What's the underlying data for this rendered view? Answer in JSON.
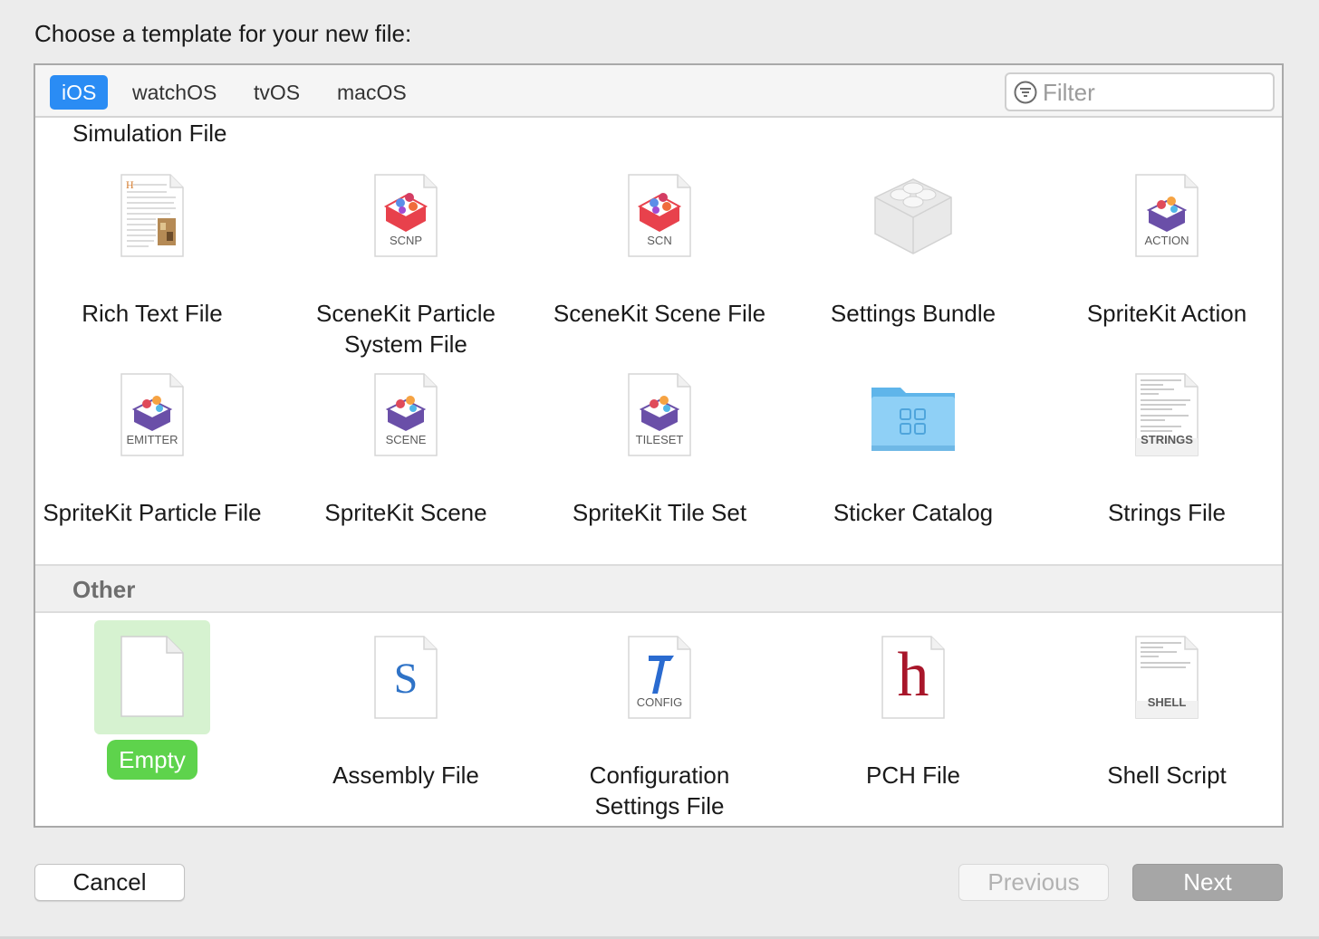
{
  "dialog": {
    "title": "Choose a template for your new file:"
  },
  "platform_tabs": [
    {
      "label": "iOS",
      "active": true
    },
    {
      "label": "watchOS",
      "active": false
    },
    {
      "label": "tvOS",
      "active": false
    },
    {
      "label": "macOS",
      "active": false
    }
  ],
  "filter": {
    "placeholder": "Filter",
    "value": ""
  },
  "sections": {
    "simulation": {
      "title": "Simulation File",
      "templates": [
        {
          "label": "Rich Text File",
          "icon": "rich-text-document-icon",
          "badge": ""
        },
        {
          "label": "SceneKit Particle System File",
          "icon": "scenekit-icon",
          "badge": "SCNP"
        },
        {
          "label": "SceneKit Scene File",
          "icon": "scenekit-icon",
          "badge": "SCN"
        },
        {
          "label": "Settings Bundle",
          "icon": "lego-brick-icon",
          "badge": ""
        },
        {
          "label": "SpriteKit Action",
          "icon": "spritekit-icon",
          "badge": "ACTION"
        },
        {
          "label": "SpriteKit Particle File",
          "icon": "spritekit-icon",
          "badge": "EMITTER"
        },
        {
          "label": "SpriteKit Scene",
          "icon": "spritekit-icon",
          "badge": "SCENE"
        },
        {
          "label": "SpriteKit Tile Set",
          "icon": "spritekit-icon",
          "badge": "TILESET"
        },
        {
          "label": "Sticker Catalog",
          "icon": "folder-icon",
          "badge": ""
        },
        {
          "label": "Strings File",
          "icon": "strings-file-icon",
          "badge": "STRINGS"
        }
      ]
    },
    "other": {
      "title": "Other",
      "templates": [
        {
          "label": "Empty",
          "icon": "empty-file-icon",
          "badge": "",
          "selected": true
        },
        {
          "label": "Assembly File",
          "icon": "assembly-file-icon",
          "badge": "S"
        },
        {
          "label": "Configuration Settings File",
          "icon": "config-file-icon",
          "badge": "CONFIG"
        },
        {
          "label": "PCH File",
          "icon": "pch-file-icon",
          "badge": "h"
        },
        {
          "label": "Shell Script",
          "icon": "shell-script-icon",
          "badge": "SHELL"
        }
      ]
    }
  },
  "buttons": {
    "cancel": "Cancel",
    "previous": "Previous",
    "next": "Next"
  },
  "colors": {
    "accent": "#2a8cf4",
    "selection": "#5ed34c",
    "selection_bg": "#d6f2d0"
  }
}
